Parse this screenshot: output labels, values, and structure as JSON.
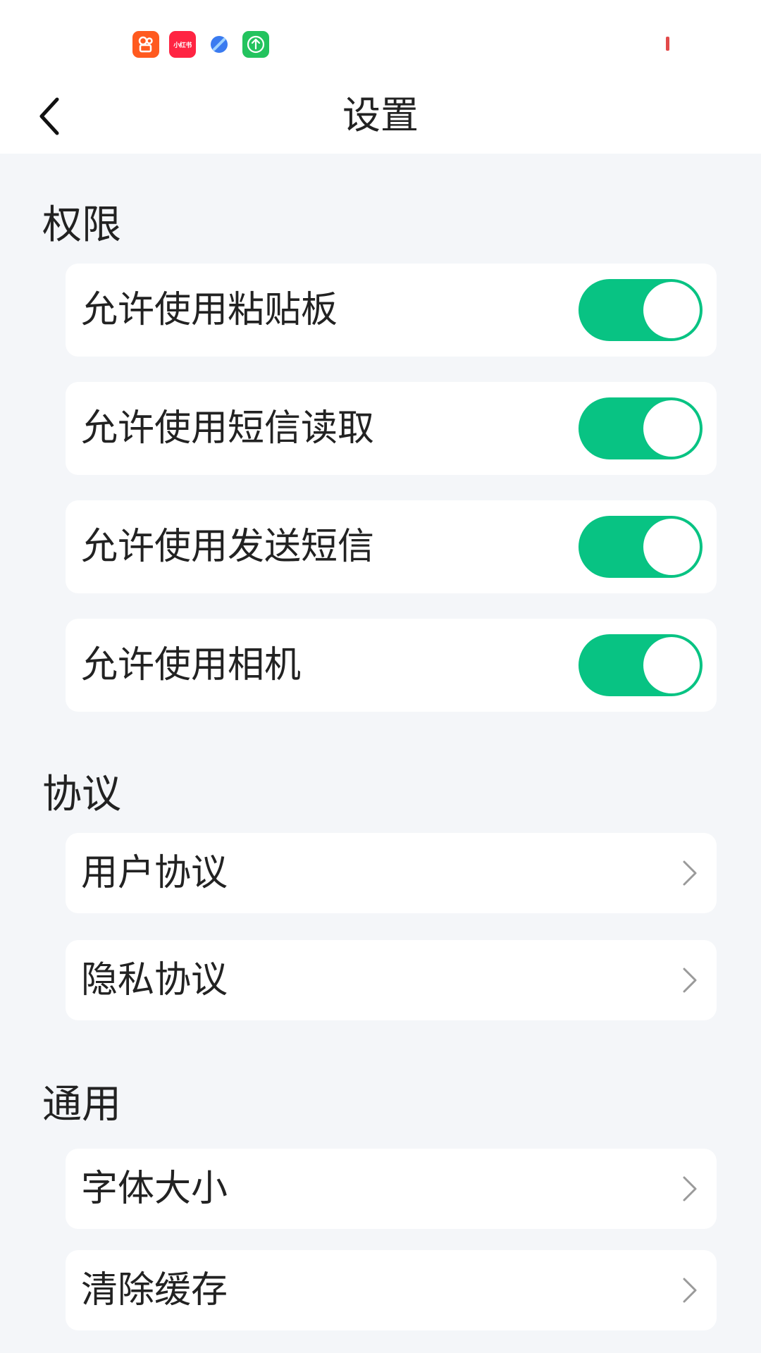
{
  "status_bar": {
    "apps": [
      {
        "name": "kuaishou-icon"
      },
      {
        "name": "xiaohongshu-icon",
        "text": "小红书"
      },
      {
        "name": "browser-icon"
      },
      {
        "name": "upload-icon"
      }
    ],
    "battery_color": "#e24a4a"
  },
  "nav": {
    "title": "设置"
  },
  "sections": {
    "permissions": {
      "title": "权限",
      "items": [
        {
          "label": "允许使用粘贴板",
          "enabled": true
        },
        {
          "label": "允许使用短信读取",
          "enabled": true
        },
        {
          "label": "允许使用发送短信",
          "enabled": true
        },
        {
          "label": "允许使用相机",
          "enabled": true
        }
      ]
    },
    "agreements": {
      "title": "协议",
      "items": [
        {
          "label": "用户协议"
        },
        {
          "label": "隐私协议"
        }
      ]
    },
    "general": {
      "title": "通用",
      "items": [
        {
          "label": "字体大小"
        },
        {
          "label": "清除缓存"
        }
      ]
    }
  },
  "colors": {
    "accent": "#08c383",
    "background": "#f4f6f9",
    "card": "#ffffff"
  }
}
